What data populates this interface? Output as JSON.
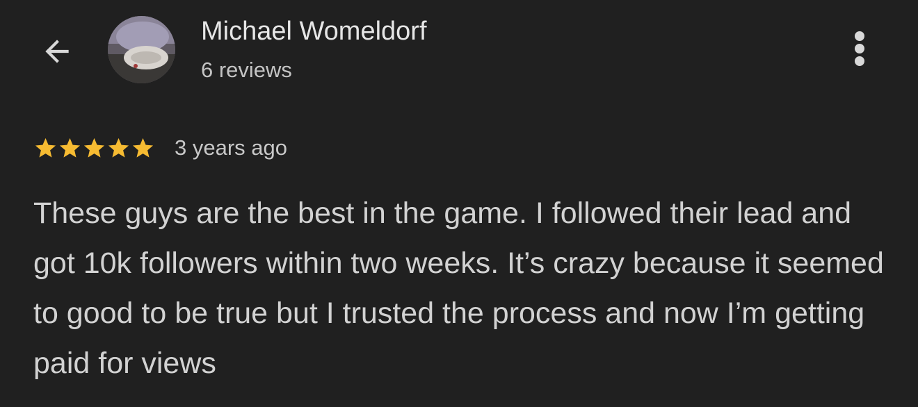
{
  "reviewer": {
    "name": "Michael Womeldorf",
    "review_count": "6 reviews"
  },
  "review": {
    "rating": 5,
    "rating_max": 5,
    "time": "3 years ago",
    "text": "These guys are the best in the game. I followed their lead and got 10k followers within two weeks. It’s crazy because it seemed to good to be true but I trusted the process and now I’m getting paid for views"
  },
  "icons": {
    "back": "arrow-back-icon",
    "more": "more-vert-icon",
    "star": "star-icon"
  },
  "colors": {
    "background": "#202020",
    "star": "#f6bb32",
    "primary_text": "#e6e6e6",
    "secondary_text": "#c4c4c4"
  }
}
